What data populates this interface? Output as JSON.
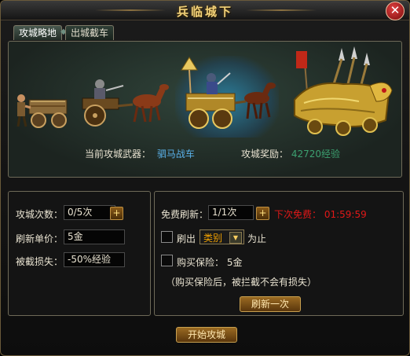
{
  "window": {
    "title": "兵临城下",
    "close_glyph": "✕"
  },
  "tabs": [
    {
      "label": "攻城略地"
    },
    {
      "label": "出城截车"
    }
  ],
  "scene": {
    "current_weapon_label": "当前攻城武器：",
    "current_weapon_value": "驷马战车",
    "reward_label": "攻城奖励：",
    "reward_value": "42720经验"
  },
  "left_panel": {
    "attack_count_label": "攻城次数：",
    "attack_count_value": "0/5次",
    "refresh_price_label": "刷新单价：",
    "refresh_price_value": "5金",
    "intercept_loss_label": "被截损失：",
    "intercept_loss_value": "-50%经验"
  },
  "right_panel": {
    "free_refresh_label": "免费刷新：",
    "free_refresh_value": "1/1次",
    "next_free_label": "下次免费：",
    "next_free_time": "01:59:59",
    "refresh_out_label": "刷出",
    "category_value": "类别",
    "until_label": "为止",
    "insurance_label": "购买保险：",
    "insurance_value": "5金",
    "insurance_note": "（购买保险后，被拦截不会有损失）",
    "refresh_once_button": "刷新一次"
  },
  "start_button": "开始攻城",
  "colors": {
    "gold": "#f2d27a",
    "blue": "#5ab0e8",
    "green": "#3ca070",
    "red": "#e01818"
  }
}
